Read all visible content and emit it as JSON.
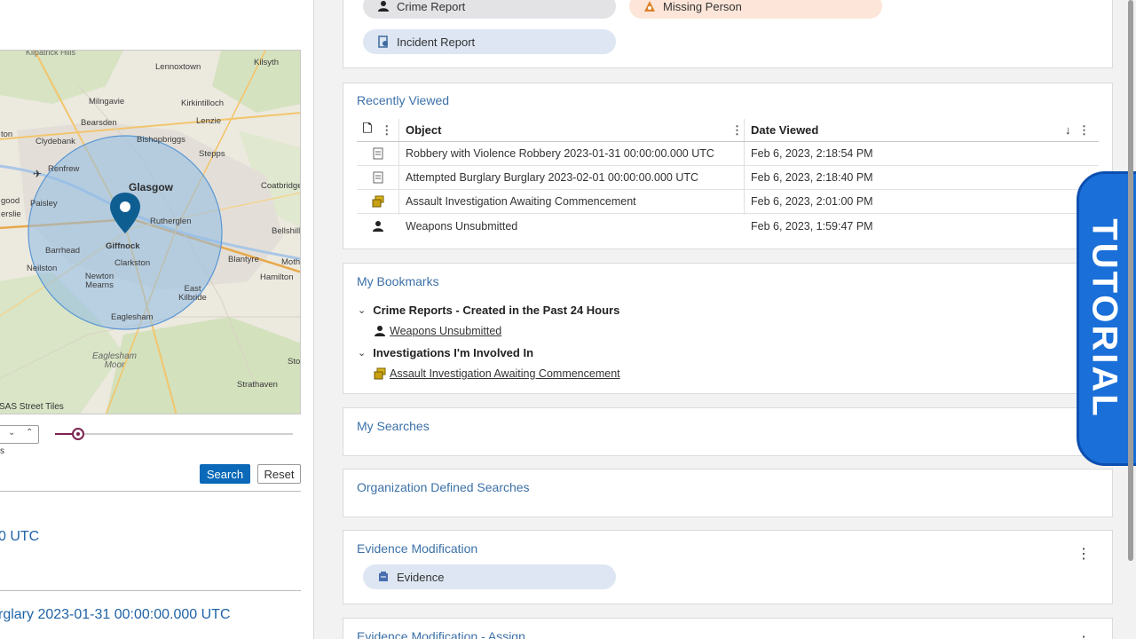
{
  "map": {
    "attribution": "SAS Street Tiles",
    "places": [
      "Kilpatrick Hills",
      "Lennoxtown",
      "Kilsyth",
      "Milngavie",
      "Kirkintilloch",
      "Bearsden",
      "Lenzie",
      "Bishopbriggs",
      "ton",
      "Clydebank",
      "Stepps",
      "Renfrew",
      "Glasgow",
      "Coatbridge",
      "Paisley",
      "Rutherglen",
      "Bellshill",
      "good",
      "erslie",
      "Barrhead",
      "Giffnock",
      "Blantyre",
      "Moth",
      "Neilston",
      "Clarkston",
      "Hamilton",
      "Newton Mearns",
      "East Kilbride",
      "Eaglesham",
      "Eaglesham Moor",
      "Sto",
      "Strathaven"
    ]
  },
  "filters": {
    "small_label": "s",
    "search_label": "Search",
    "reset_label": "Reset"
  },
  "results": [
    {
      "text": "0 UTC"
    },
    {
      "text": "rglary 2023-01-31 00:00:00.000 UTC"
    }
  ],
  "create_card": {
    "pills": [
      {
        "label": "Crime Report",
        "icon": "crime-report-icon"
      },
      {
        "label": "Missing Person",
        "icon": "missing-person-icon"
      },
      {
        "label": "Incident Report",
        "icon": "incident-report-icon"
      }
    ]
  },
  "recently_viewed": {
    "title": "Recently Viewed",
    "columns": {
      "object": "Object",
      "date": "Date Viewed"
    },
    "sort_indicator": "↓",
    "rows": [
      {
        "object": "Robbery with Violence Robbery 2023-01-31 00:00:00.000 UTC",
        "date": "Feb 6, 2023, 2:18:54 PM",
        "icon": "document-icon"
      },
      {
        "object": "Attempted Burglary Burglary 2023-02-01 00:00:00.000 UTC",
        "date": "Feb 6, 2023, 2:18:40 PM",
        "icon": "document-icon"
      },
      {
        "object": "Assault Investigation Awaiting Commencement",
        "date": "Feb 6, 2023, 2:01:00 PM",
        "icon": "investigation-folder-icon"
      },
      {
        "object": "Weapons Unsubmitted",
        "date": "Feb 6, 2023, 1:59:47 PM",
        "icon": "crime-report-icon"
      }
    ]
  },
  "bookmarks": {
    "title": "My Bookmarks",
    "groups": [
      {
        "label": "Crime Reports - Created in the Past 24 Hours",
        "items": [
          {
            "label": "Weapons Unsubmitted"
          }
        ]
      },
      {
        "label": "Investigations I'm Involved In",
        "items": [
          {
            "label": "Assault Investigation Awaiting Commencement"
          }
        ]
      }
    ]
  },
  "my_searches": {
    "title": "My Searches"
  },
  "org_searches": {
    "title": "Organization Defined Searches"
  },
  "evidence_mod": {
    "title": "Evidence Modification",
    "pill": "Evidence"
  },
  "evidence_assign": {
    "title": "Evidence Modification - Assign"
  },
  "tutorial": {
    "label": "TUTORIAL"
  },
  "colors": {
    "accent": "#0a69b8",
    "link": "#3c71a8",
    "slider": "#7b2350",
    "tutorial": "#1a6fd8"
  }
}
